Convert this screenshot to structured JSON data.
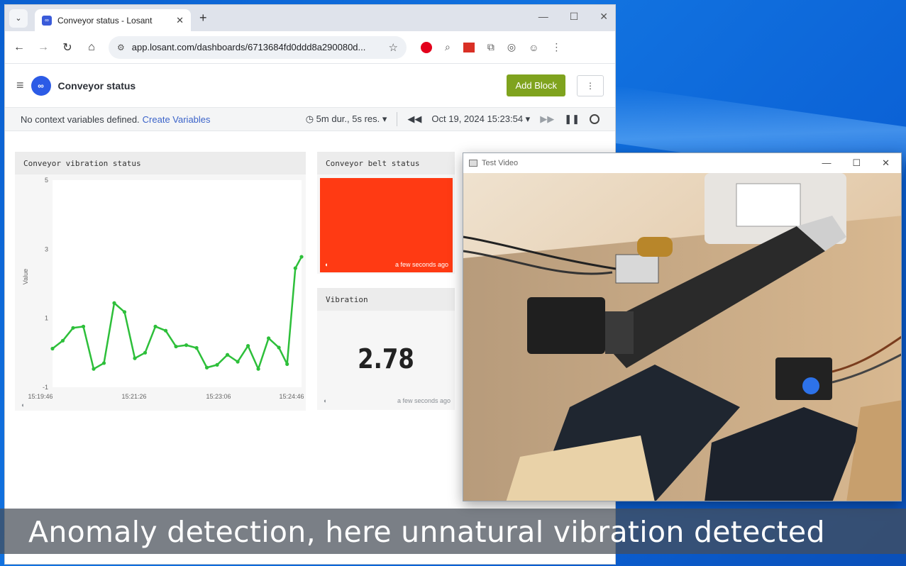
{
  "browser": {
    "tab_title": "Conveyor status - Losant",
    "url": "app.losant.com/dashboards/6713684fd0ddd8a290080d..."
  },
  "app": {
    "dashboard_title": "Conveyor status",
    "add_block_label": "Add Block",
    "context_text": "No context variables defined.",
    "context_link": "Create Variables",
    "duration_label": "5m dur., 5s res.",
    "timestamp_label": "Oct 19, 2024 15:23:54"
  },
  "blocks": {
    "chart": {
      "title": "Conveyor vibration status"
    },
    "belt": {
      "title": "Conveyor belt status",
      "updated": "a few seconds ago",
      "status_color": "#ff3a13"
    },
    "vibration": {
      "title": "Vibration",
      "value": "2.78",
      "updated": "a few seconds ago"
    }
  },
  "chart_data": {
    "type": "line",
    "title": "Conveyor vibration status",
    "xlabel": "",
    "ylabel": "Value",
    "x_tick_labels": [
      "15:19:46",
      "15:21:26",
      "15:23:06",
      "15:24:46"
    ],
    "y_tick_labels": [
      "5",
      "3",
      "1",
      "-1"
    ],
    "ylim": [
      -1,
      5
    ],
    "series_color": "#2dbf3a",
    "points": [
      [
        0,
        0.12
      ],
      [
        5,
        0.35
      ],
      [
        10,
        0.72
      ],
      [
        15,
        0.76
      ],
      [
        20,
        -0.47
      ],
      [
        25,
        -0.3
      ],
      [
        30,
        1.44
      ],
      [
        35,
        1.18
      ],
      [
        40,
        -0.16
      ],
      [
        45,
        0.0
      ],
      [
        50,
        0.76
      ],
      [
        55,
        0.64
      ],
      [
        60,
        0.18
      ],
      [
        65,
        0.22
      ],
      [
        70,
        0.14
      ],
      [
        75,
        -0.43
      ],
      [
        80,
        -0.35
      ],
      [
        85,
        -0.06
      ],
      [
        90,
        -0.26
      ],
      [
        95,
        0.2
      ],
      [
        100,
        -0.47
      ],
      [
        105,
        0.42
      ],
      [
        110,
        0.15
      ],
      [
        114,
        -0.33
      ],
      [
        118,
        2.45
      ],
      [
        121,
        2.78
      ]
    ]
  },
  "video": {
    "window_title": "Test Video"
  },
  "caption": "Anomaly detection, here unnatural vibration detected"
}
